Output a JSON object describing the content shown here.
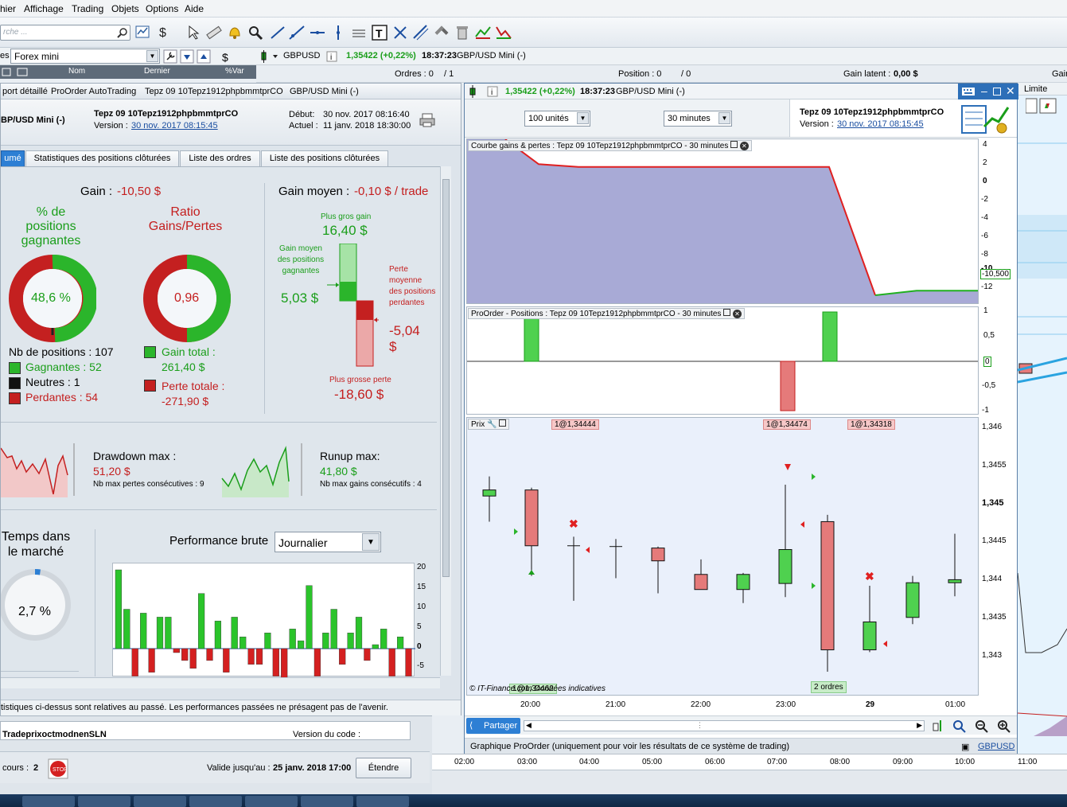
{
  "menu": [
    "hier",
    "Affichage",
    "Trading",
    "Objets",
    "Options",
    "Aide"
  ],
  "search": {
    "placeholder": "rche ..."
  },
  "instrument": {
    "list_label": "es",
    "list_name": "Forex mini",
    "symbol": "GBPUSD",
    "price": "1,35422 (+0,22%)",
    "time": "18:37:23",
    "name": "GBP/USD Mini (-)"
  },
  "list_header": {
    "col_name": "Nom",
    "col_last": "Dernier",
    "col_var": "%Var"
  },
  "order_bar": {
    "orders": "Ordres : 0",
    "slash1": "/ 1",
    "position": "Position : 0",
    "slash2": "/ 0",
    "gain_latent_label": "Gain latent :",
    "gain_latent_value": "0,00 $",
    "gain_cut": "Gair"
  },
  "left_panel": {
    "tabs1": [
      "port détaillé",
      "ProOrder AutoTrading",
      "Tepz 09 10Tepz1912phpbmmtprCO",
      "GBP/USD Mini (-)"
    ],
    "instrument_short": "BP/USD Mini (-)",
    "system_name": "Tepz 09 10Tepz1912phpbmmtprCO",
    "version_label": "Version :",
    "version_date": "30 nov. 2017 08:15:45",
    "debut_label": "Début:",
    "debut_value": "30 nov. 2017 08:16:40",
    "actuel_label": "Actuel :",
    "actuel_value": "11 janv. 2018 18:30:00",
    "tabs2": [
      "umé",
      "Statistiques des positions clôturées",
      "Liste des ordres",
      "Liste des positions clôturées"
    ],
    "gain_label": "Gain :",
    "gain_value": "-10,50 $",
    "pct_title": "% de positions gagnantes",
    "pct_value": "48,6 %",
    "ratio_title": "Ratio Gains/Pertes",
    "ratio_value": "0,96",
    "nb_positions": "Nb de positions : 107",
    "gagnantes": "Gagnantes : 52",
    "neutres": "Neutres : 1",
    "perdantes": "Perdantes : 54",
    "gain_total_label": "Gain total :",
    "gain_total_value": "261,40 $",
    "perte_totale_label": "Perte totale :",
    "perte_totale_value": "-271,90 $",
    "gain_moyen_label": "Gain moyen :",
    "gain_moyen_value": "-0,10 $ / trade",
    "plus_gros_gain_label": "Plus gros gain",
    "plus_gros_gain_value": "16,40 $",
    "gain_moyen_pos_label": "Gain moyen des positions gagnantes",
    "gain_moyen_pos_value": "5,03 $",
    "perte_moyenne_label": "Perte moyenne des positions perdantes",
    "perte_moyenne_value": "-5,04",
    "perte_moyenne_unit": "$",
    "plus_grosse_perte_label": "Plus grosse perte",
    "plus_grosse_perte_value": "-18,60 $",
    "drawdown_label": "Drawdown max :",
    "drawdown_value": "51,20 $",
    "nb_max_pertes": "Nb max pertes consécutives : 9",
    "runup_label": "Runup max:",
    "runup_value": "41,80 $",
    "nb_max_gains": "Nb max gains consécutifs : 4",
    "temps_label": "Temps dans le marché",
    "temps_value": "2,7 %",
    "perf_label": "Performance brute",
    "perf_select": "Journalier",
    "perf_axis": [
      "20",
      "15",
      "10",
      "5",
      "0",
      "-5"
    ],
    "disclaimer": "tistiques ci-dessus sont relatives au passé. Les performances passées ne présagent pas de l'avenir."
  },
  "bottom": {
    "row_name": "TradeprixoctmodnenSLN",
    "version_code": "Version du code :",
    "cours": "cours :",
    "cours_value": "2",
    "valide_label": "Valide jusqu'au :",
    "valide_value": "25 janv. 2018 17:00",
    "etendre": "Étendre"
  },
  "right_window": {
    "price": "1,35422 (+0,22%)",
    "time": "18:37:23",
    "name": "GBP/USD Mini (-)",
    "units": "100 unités",
    "timeframe": "30 minutes",
    "system_name": "Tepz 09 10Tepz1912phpbmmtprCO",
    "version_label": "Version :",
    "version_date": "30 nov. 2017 08:15:45",
    "equity_title": "Courbe gains & pertes : Tepz 09 10Tepz1912phpbmmtprCO - 30 minutes",
    "equity_axis": [
      "4",
      "2",
      "0",
      "-2",
      "-4",
      "-6",
      "-8",
      "-10",
      "-12"
    ],
    "equity_last": "-10,500",
    "positions_title": "ProOrder - Positions : Tepz 09 10Tepz1912phpbmmtprCO - 30 minutes",
    "positions_axis": [
      "1",
      "0,5",
      "0",
      "-0,5",
      "-1"
    ],
    "price_title": "Prix",
    "price_axis": [
      "1,346",
      "1,3455",
      "1,345",
      "1,3445",
      "1,344",
      "1,3435",
      "1,343"
    ],
    "order_tags": [
      "1@1,34444",
      "1@1,34474",
      "1@1,34318"
    ],
    "bottom_tag": "1@1,34462",
    "orders_tag": "2 ordres",
    "copyright": "© IT-Finance.com Données indicatives",
    "time_axis": [
      "20:00",
      "21:00",
      "22:00",
      "23:00",
      "29",
      "01:00"
    ],
    "share": "Partager",
    "footer": "Graphique ProOrder (uniquement pour voir les résultats de ce système de trading)",
    "footer_symbol": "GBPUSD"
  },
  "bg_chart": {
    "limite": "Limite",
    "time_axis": [
      "02:00",
      "03:00",
      "04:00",
      "05:00",
      "06:00",
      "07:00",
      "08:00",
      "09:00",
      "10:00",
      "11:00"
    ]
  },
  "colors": {
    "green": "#1a9e1a",
    "red": "#c41e1e",
    "equity_fill": "#a8aad6",
    "bull": "#4fd14f",
    "bear": "#e57a7a"
  },
  "chart_data": [
    {
      "type": "area",
      "title": "Courbe gains & pertes : Tepz 09 10Tepz1912phpbmmtprCO - 30 minutes",
      "ylim": [
        -12.5,
        4
      ],
      "x": [
        0,
        1,
        2,
        3,
        4,
        5,
        6,
        7,
        8,
        9,
        10,
        11,
        12
      ],
      "values": [
        5,
        1.8,
        1.5,
        1.5,
        1.5,
        1.5,
        1.5,
        1.5,
        1.5,
        -12.5,
        -12,
        -12,
        -12
      ]
    },
    {
      "type": "bar",
      "title": "ProOrder - Positions : Tepz 09 10Tepz1912phpbmmtprCO - 30 minutes",
      "ylim": [
        -1,
        1
      ],
      "x": [
        "19:30",
        "23:00",
        "23:30"
      ],
      "values": [
        1,
        -1,
        1
      ]
    },
    {
      "type": "candlestick",
      "title": "Prix",
      "ylim": [
        1.3425,
        1.3462
      ],
      "candles": [
        {
          "o": 1.34519,
          "h": 1.34545,
          "l": 1.34485,
          "c": 1.34527
        },
        {
          "o": 1.34527,
          "h": 1.3453,
          "l": 1.34413,
          "c": 1.34453
        },
        {
          "o": 1.34453,
          "h": 1.34465,
          "l": 1.3438,
          "c": 1.34452
        },
        {
          "o": 1.34452,
          "h": 1.34462,
          "l": 1.3441,
          "c": 1.34452
        },
        {
          "o": 1.3445,
          "h": 1.34452,
          "l": 1.3439,
          "c": 1.34433
        },
        {
          "o": 1.34415,
          "h": 1.34435,
          "l": 1.34407,
          "c": 1.34395
        },
        {
          "o": 1.34395,
          "h": 1.34417,
          "l": 1.34377,
          "c": 1.34415
        },
        {
          "o": 1.34403,
          "h": 1.34534,
          "l": 1.34385,
          "c": 1.34448
        },
        {
          "o": 1.34485,
          "h": 1.34494,
          "l": 1.34286,
          "c": 1.34315
        },
        {
          "o": 1.34315,
          "h": 1.344,
          "l": 1.34312,
          "c": 1.34352
        },
        {
          "o": 1.34358,
          "h": 1.34413,
          "l": 1.34349,
          "c": 1.34404
        },
        {
          "o": 1.34404,
          "h": 1.34469,
          "l": 1.34386,
          "c": 1.34408
        }
      ]
    },
    {
      "type": "bar",
      "title": "Performance brute",
      "ylim": [
        -7,
        21
      ],
      "values": [
        20,
        10,
        -7,
        9,
        -6,
        8,
        8,
        -1,
        -3,
        -5,
        14,
        -3,
        7,
        -6,
        8,
        3,
        -4,
        -4,
        4,
        -7,
        -8,
        5,
        2,
        16,
        -7,
        4,
        10,
        -4,
        4,
        8,
        -3,
        1,
        5,
        -7,
        3,
        -7
      ]
    }
  ]
}
